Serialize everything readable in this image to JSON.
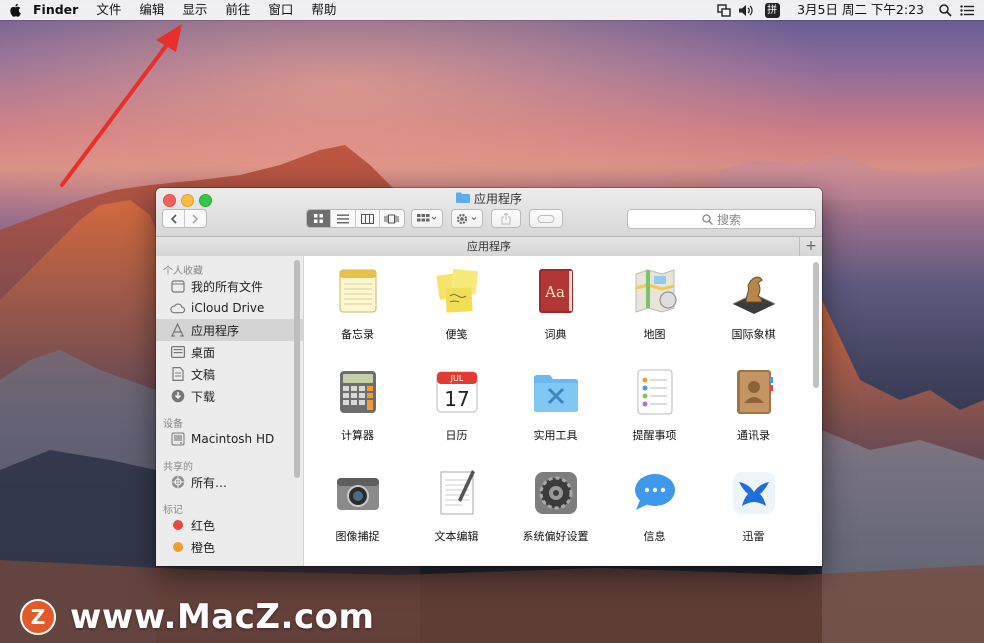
{
  "menubar": {
    "items": [
      "Finder",
      "文件",
      "编辑",
      "显示",
      "前往",
      "窗口",
      "帮助"
    ],
    "clock": "3月5日 周二 下午2:23",
    "input_method": "拼"
  },
  "finder": {
    "title": "应用程序",
    "path_title": "应用程序",
    "search_placeholder": "搜索",
    "path_plus": "+",
    "sidebar": {
      "favorites_heading": "个人收藏",
      "favorites": [
        {
          "label": "我的所有文件",
          "icon": "all-files-icon"
        },
        {
          "label": "iCloud Drive",
          "icon": "cloud-icon"
        },
        {
          "label": "应用程序",
          "icon": "applications-icon",
          "selected": true
        },
        {
          "label": "桌面",
          "icon": "desktop-icon"
        },
        {
          "label": "文稿",
          "icon": "document-icon"
        },
        {
          "label": "下载",
          "icon": "download-icon"
        }
      ],
      "devices_heading": "设备",
      "devices": [
        {
          "label": "Macintosh HD",
          "icon": "hard-drive-icon"
        }
      ],
      "shared_heading": "共享的",
      "shared": [
        {
          "label": "所有…",
          "icon": "network-icon"
        }
      ],
      "tags_heading": "标记",
      "tags": [
        {
          "label": "红色",
          "color": "#e8473d"
        },
        {
          "label": "橙色",
          "color": "#f39c2f"
        }
      ]
    },
    "apps": [
      {
        "label": "备忘录",
        "icon": "notes-icon"
      },
      {
        "label": "便笺",
        "icon": "stickies-icon"
      },
      {
        "label": "词典",
        "icon": "dictionary-icon"
      },
      {
        "label": "地图",
        "icon": "maps-icon"
      },
      {
        "label": "国际象棋",
        "icon": "chess-icon"
      },
      {
        "label": "计算器",
        "icon": "calculator-icon"
      },
      {
        "label": "日历",
        "icon": "calendar-icon"
      },
      {
        "label": "实用工具",
        "icon": "utilities-folder-icon"
      },
      {
        "label": "提醒事项",
        "icon": "reminders-icon"
      },
      {
        "label": "通讯录",
        "icon": "contacts-icon"
      },
      {
        "label": "图像捕捉",
        "icon": "image-capture-icon"
      },
      {
        "label": "文本编辑",
        "icon": "textedit-icon"
      },
      {
        "label": "系统偏好设置",
        "icon": "system-preferences-icon"
      },
      {
        "label": "信息",
        "icon": "messages-icon"
      },
      {
        "label": "迅雷",
        "icon": "thunder-icon"
      }
    ],
    "calendar_month": "JUL",
    "calendar_day": "17",
    "dictionary_text": "Aa"
  },
  "watermark": {
    "logo_letter": "Z",
    "text": "www.MacZ.com"
  },
  "colors": {
    "accent_arrow": "#e8302a",
    "close": "#fc605c",
    "minimize": "#fdbc40",
    "zoom": "#34c84a"
  }
}
